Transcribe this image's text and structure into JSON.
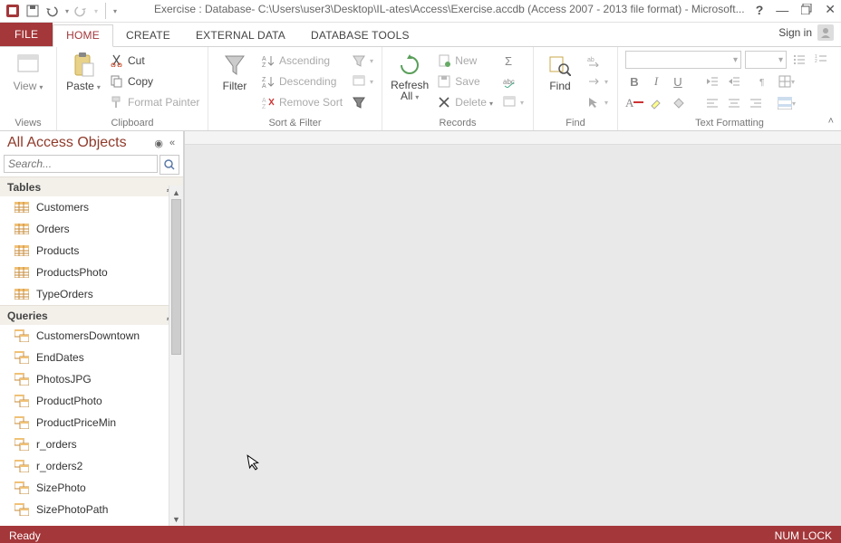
{
  "window": {
    "title": "Exercise : Database- C:\\Users\\user3\\Desktop\\IL-ates\\Access\\Exercise.accdb (Access 2007 - 2013 file format) - Microsoft...",
    "sign_in": "Sign in"
  },
  "tabs": {
    "file": "FILE",
    "home": "HOME",
    "create": "CREATE",
    "external_data": "EXTERNAL DATA",
    "database_tools": "DATABASE TOOLS"
  },
  "ribbon": {
    "views": {
      "view": "View",
      "group": "Views"
    },
    "clipboard": {
      "paste": "Paste",
      "cut": "Cut",
      "copy": "Copy",
      "format_painter": "Format Painter",
      "group": "Clipboard"
    },
    "sortfilter": {
      "filter": "Filter",
      "ascending": "Ascending",
      "descending": "Descending",
      "remove_sort": "Remove Sort",
      "group": "Sort & Filter"
    },
    "records": {
      "refresh": "Refresh\nAll",
      "new": "New",
      "save": "Save",
      "delete": "Delete",
      "group": "Records"
    },
    "find": {
      "find": "Find",
      "group": "Find"
    },
    "text_formatting": {
      "group": "Text Formatting"
    }
  },
  "nav": {
    "title": "All Access Objects",
    "search_placeholder": "Search...",
    "sections": {
      "tables": "Tables",
      "queries": "Queries"
    },
    "tables": [
      "Customers",
      "Orders",
      "Products",
      "ProductsPhoto",
      "TypeOrders"
    ],
    "queries": [
      "CustomersDowntown",
      "EndDates",
      "PhotosJPG",
      "ProductPhoto",
      "ProductPriceMin",
      "r_orders",
      "r_orders2",
      "SizePhoto",
      "SizePhotoPath"
    ]
  },
  "status": {
    "left": "Ready",
    "right": "NUM LOCK"
  }
}
